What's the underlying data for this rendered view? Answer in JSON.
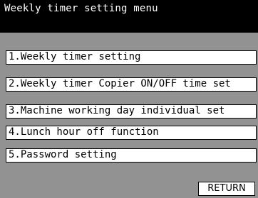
{
  "header": {
    "title": "Weekly timer setting menu"
  },
  "menu": {
    "items": [
      {
        "label": "1.Weekly timer setting"
      },
      {
        "label": "2.Weekly timer Copier ON/OFF time set"
      },
      {
        "label": "3.Machine working day individual set"
      },
      {
        "label": "4.Lunch hour off function"
      },
      {
        "label": "5.Password setting"
      }
    ]
  },
  "footer": {
    "return_label": "RETURN"
  },
  "colors": {
    "header_bg": "#000000",
    "item_bg": "#ffffff",
    "panel_bg": "#c8c8c8"
  }
}
